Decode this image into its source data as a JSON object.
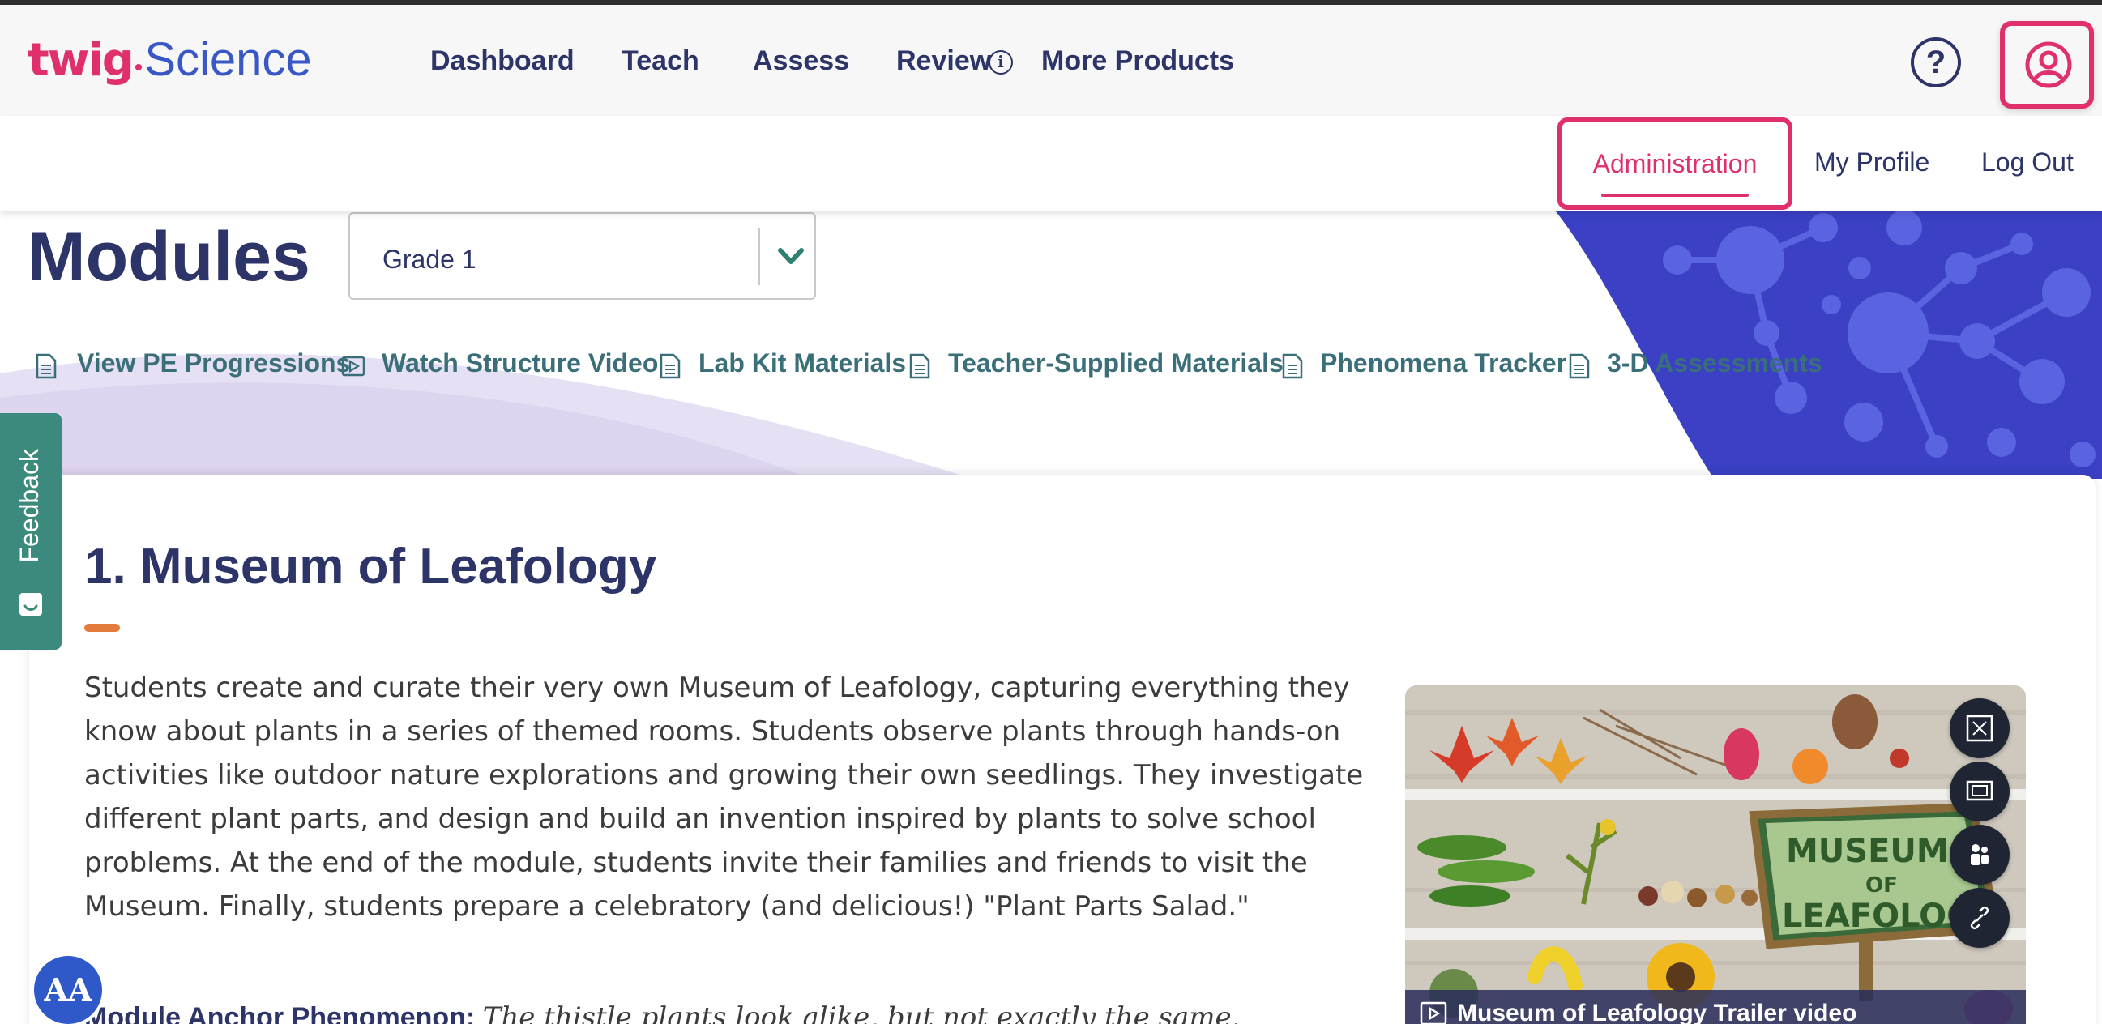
{
  "brand": {
    "logo_part1": "twig",
    "logo_part2": "Science",
    "accent_color": "#e0306b",
    "primary_color": "#2c3468"
  },
  "nav": {
    "items": [
      {
        "label": "Dashboard"
      },
      {
        "label": "Teach"
      },
      {
        "label": "Assess"
      },
      {
        "label": "Review"
      },
      {
        "label": "More Products"
      }
    ],
    "help_icon": "question-circle-icon",
    "profile_icon": "user-circle-icon"
  },
  "subnav": {
    "items": [
      {
        "label": "Administration",
        "active": true
      },
      {
        "label": "My Profile"
      },
      {
        "label": "Log Out"
      }
    ]
  },
  "page": {
    "title": "Modules",
    "grade_select": {
      "value": "Grade 1"
    }
  },
  "quick_links": [
    {
      "label": "View PE Progressions",
      "icon": "document-icon"
    },
    {
      "label": "Watch Structure Video",
      "icon": "video-icon"
    },
    {
      "label": "Lab Kit Materials",
      "icon": "document-icon"
    },
    {
      "label": "Teacher-Supplied Materials",
      "icon": "document-icon"
    },
    {
      "label": "Phenomena Tracker",
      "icon": "document-icon"
    },
    {
      "label": "3-D Assessments",
      "icon": "document-icon"
    }
  ],
  "module": {
    "title": "1. Museum of Leafology",
    "description": "Students create and curate their very own Museum of Leafology, capturing everything they know about plants in a series of themed rooms. Students observe plants through hands-on activities like outdoor nature explorations and growing their own seedlings. They investigate different plant parts, and design and build an invention inspired by plants to solve school problems. At the end of the module, students invite their families and friends to visit the Museum. Finally, students prepare a celebratory (and delicious!) \"Plant Parts Salad.\"",
    "anchor_label": "Module Anchor Phenomenon:",
    "anchor_text": "The thistle plants look alike, but not exactly the same.",
    "video": {
      "caption": "Museum of Leafology Trailer video",
      "sign_line1": "MUSEUM",
      "sign_line2": "OF",
      "sign_line3": "LEAFOLOGY",
      "buttons": [
        "fullscreen-icon",
        "slideshow-icon",
        "presenter-icon",
        "link-icon"
      ]
    }
  },
  "feedback": {
    "label": "Feedback"
  },
  "accessibility": {
    "label": "AA"
  }
}
